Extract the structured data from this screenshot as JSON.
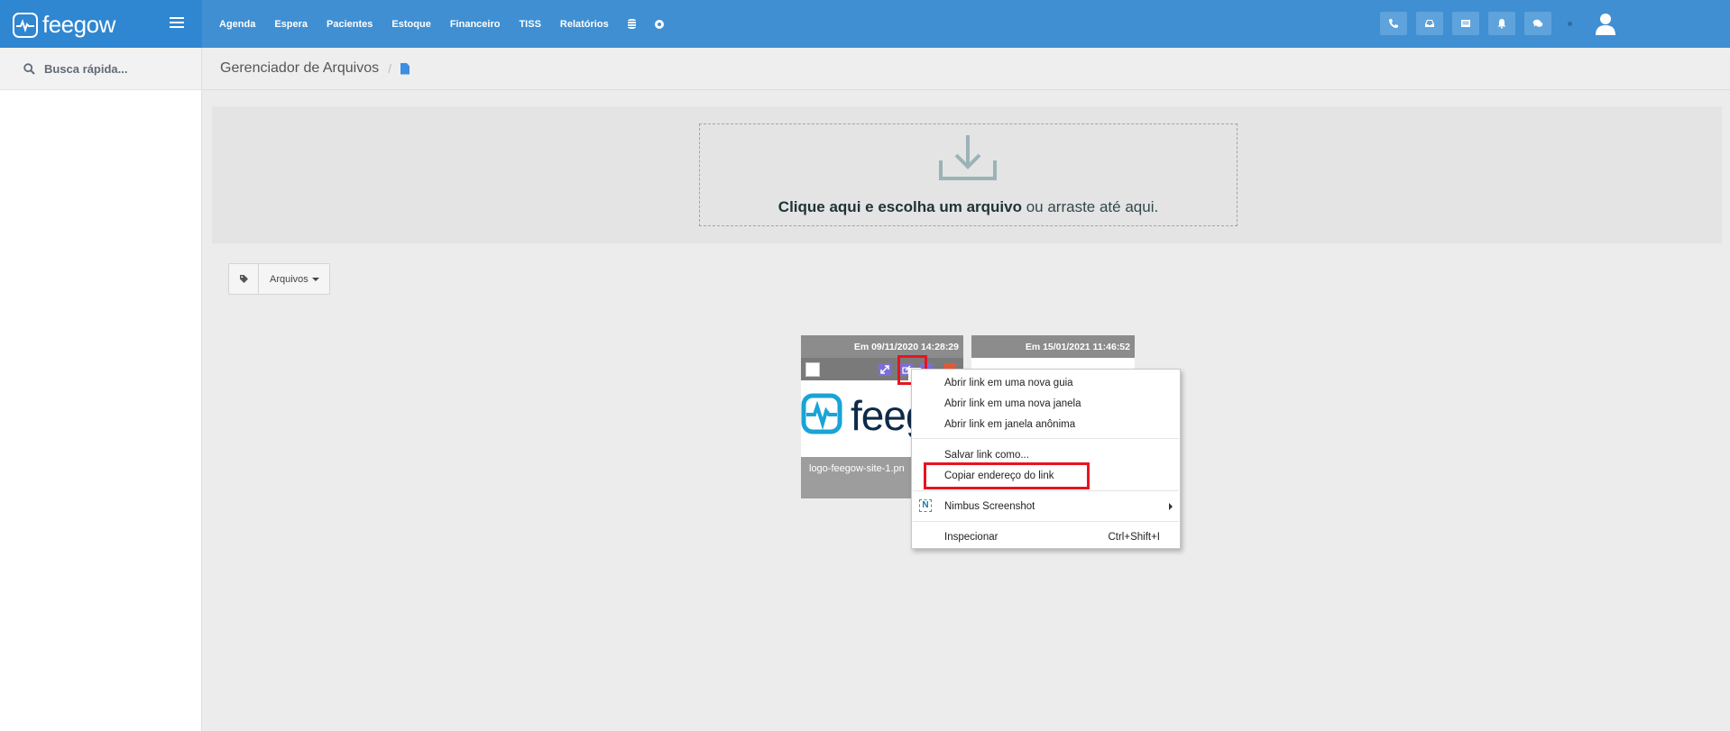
{
  "app": {
    "brand": "feegow"
  },
  "nav": {
    "items": [
      "Agenda",
      "Espera",
      "Pacientes",
      "Estoque",
      "Financeiro",
      "TISS",
      "Relatórios"
    ]
  },
  "sidebar": {
    "search_placeholder": "Busca rápida..."
  },
  "breadcrumb": {
    "title": "Gerenciador de Arquivos",
    "separator": "/"
  },
  "upload": {
    "bold_text": "Clique aqui e escolha um arquivo",
    "rest_text": " ou arraste até aqui."
  },
  "filter": {
    "files_label": "Arquivos"
  },
  "files": [
    {
      "date_label": "Em 09/11/2020 14:28:29",
      "name": "logo-feegow-site-1.pn",
      "thumb_text": "feeg"
    },
    {
      "date_label": "Em 15/01/2021 11:46:52"
    }
  ],
  "context_menu": {
    "open_new_tab": "Abrir link em uma nova guia",
    "open_new_window": "Abrir link em uma nova janela",
    "open_incognito": "Abrir link em janela anônima",
    "save_link": "Salvar link como...",
    "copy_link": "Copiar endereço do link",
    "nimbus": "Nimbus Screenshot",
    "inspect": "Inspecionar",
    "inspect_shortcut": "Ctrl+Shift+I"
  },
  "colors": {
    "topbar": "#3f8fd2",
    "highlight": "#e8131f",
    "action_purple": "#7b6fd6",
    "delete_red": "#e05a3a"
  }
}
